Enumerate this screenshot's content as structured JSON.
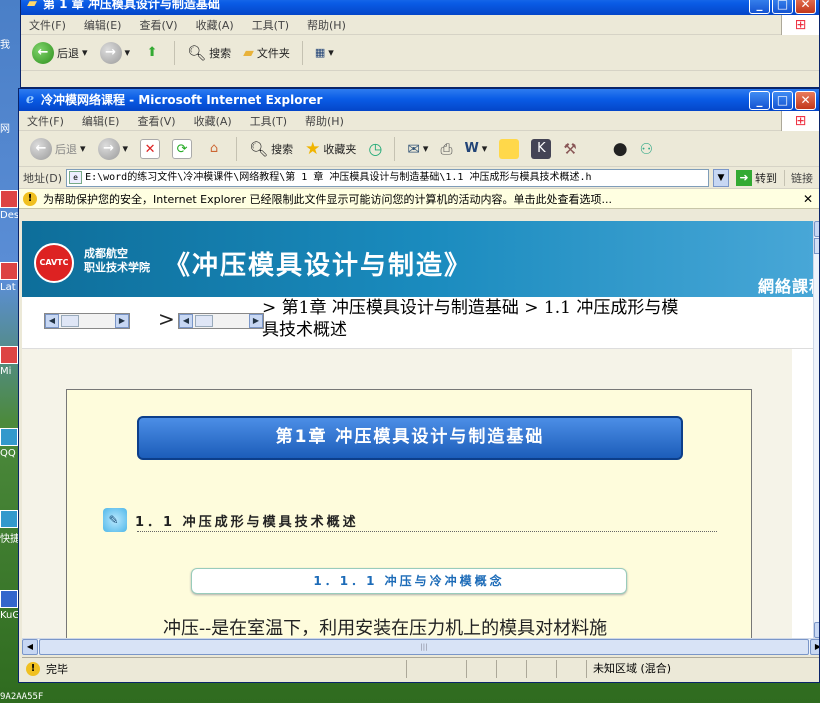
{
  "desktop": {
    "icon_labels": [
      "我",
      "网",
      "Des",
      "Lat",
      "Mi",
      "QQ",
      "快捷 Co",
      "KuG"
    ],
    "bottom_text": "9A2AA55F"
  },
  "back_window": {
    "title": "第 1 章 冲压模具设计与制造基础",
    "menu": [
      "文件(F)",
      "编辑(E)",
      "查看(V)",
      "收藏(A)",
      "工具(T)",
      "帮助(H)"
    ],
    "toolbar": {
      "back": "后退",
      "search": "搜索",
      "folders": "文件夹"
    }
  },
  "window": {
    "title": "冷冲模网络课程 - Microsoft Internet Explorer",
    "controls": {
      "minimize": "_",
      "maximize": "□",
      "close": "✕"
    },
    "menu": [
      "文件(F)",
      "编辑(E)",
      "查看(V)",
      "收藏(A)",
      "工具(T)",
      "帮助(H)"
    ],
    "toolbar": {
      "back": "后退",
      "search": "搜索",
      "favorites": "收藏夹"
    },
    "address": {
      "label": "地址(D)",
      "value": "E:\\word的练习文件\\冷冲模课件\\网络教程\\第 1 章 冲压模具设计与制造基础\\1.1 冲压成形与模具技术概述.h",
      "go": "转到",
      "links": "链接"
    },
    "infobar": "为帮助保护您的安全，Internet Explorer 已经限制此文件显示可能访问您的计算机的活动内容。单击此处查看选项..."
  },
  "page": {
    "banner": {
      "logo": "CAVTC",
      "school_line1": "成都航空",
      "school_line2": "职业技术学院",
      "title": "《冲压模具设计与制造》",
      "subtitle": "網絡課程"
    },
    "breadcrumb": "> 第1章 冲压模具设计与制造基础 > 1.1 冲压成形与模具技术概述",
    "nav_separator": ">",
    "chapter_title": "第1章  冲压模具设计与制造基础",
    "section_title": "1．1  冲压成形与模具技术概述",
    "subsection_title": "1．1．1  冲压与冷冲模概念",
    "body_text": "冲压--是在室温下，利用安装在压力机上的模具对材料施"
  },
  "status": {
    "text": "完毕",
    "zone": "未知区域 (混合)"
  },
  "colors": {
    "titlebar": "#0a5ce6",
    "banner": "#1a8bbe",
    "paper": "#fefcdc",
    "chapter_button": "#1c5db9"
  }
}
